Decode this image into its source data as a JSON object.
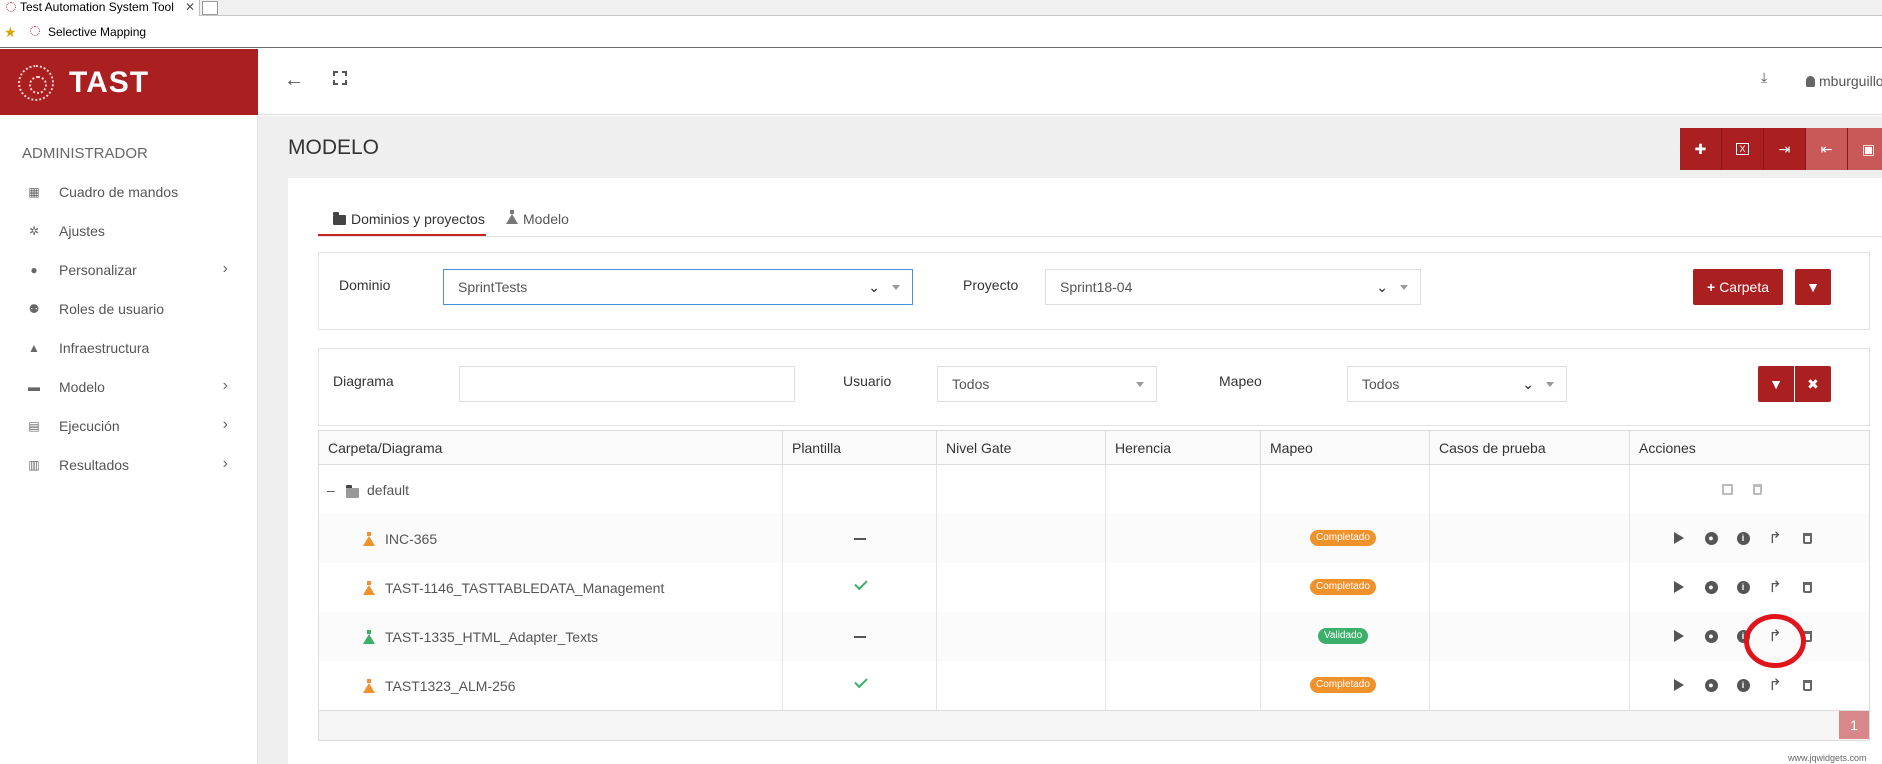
{
  "browser": {
    "tab_title": "Test Automation System Tool",
    "favorite_label": "Selective Mapping"
  },
  "brand": {
    "name": "TAST",
    "color": "#aa1f1f"
  },
  "sidebar": {
    "section": "ADMINISTRADOR",
    "items": [
      {
        "label": "Cuadro de mandos",
        "icon": "dashboard-icon",
        "has_submenu": false
      },
      {
        "label": "Ajustes",
        "icon": "gear-icon",
        "has_submenu": false
      },
      {
        "label": "Personalizar",
        "icon": "palette-icon",
        "has_submenu": true
      },
      {
        "label": "Roles de usuario",
        "icon": "users-icon",
        "has_submenu": false
      },
      {
        "label": "Infraestructura",
        "icon": "road-icon",
        "has_submenu": false
      },
      {
        "label": "Modelo",
        "icon": "briefcase-icon",
        "has_submenu": true
      },
      {
        "label": "Ejecución",
        "icon": "calendar-icon",
        "has_submenu": true
      },
      {
        "label": "Resultados",
        "icon": "bar-chart-icon",
        "has_submenu": true
      }
    ]
  },
  "header": {
    "username": "mburguillo"
  },
  "page": {
    "title": "MODELO"
  },
  "toolbar": [
    "add-icon",
    "excel-icon",
    "import-icon",
    "export-icon",
    "save-icon"
  ],
  "tabs": [
    {
      "label": "Dominios y proyectos",
      "active": true
    },
    {
      "label": "Modelo",
      "active": false
    }
  ],
  "filters1": {
    "dominio_label": "Dominio",
    "dominio_value": "SprintTests",
    "proyecto_label": "Proyecto",
    "proyecto_value": "Sprint18-04",
    "carpeta_button": "Carpeta"
  },
  "filters2": {
    "diagrama_label": "Diagrama",
    "diagrama_value": "",
    "usuario_label": "Usuario",
    "usuario_value": "Todos",
    "mapeo_label": "Mapeo",
    "mapeo_value": "Todos"
  },
  "grid": {
    "columns": [
      "Carpeta/Diagrama",
      "Plantilla",
      "Nivel Gate",
      "Herencia",
      "Mapeo",
      "Casos de prueba",
      "Acciones"
    ],
    "folder": {
      "name": "default",
      "expanded_symbol": "–"
    },
    "rows": [
      {
        "name": "INC-365",
        "plantilla": "dash",
        "mapeo": "Completado",
        "status_color": "#f0922b"
      },
      {
        "name": "TAST-1146_TASTTABLEDATA_Management",
        "plantilla": "check",
        "mapeo": "Completado",
        "status_color": "#f0922b"
      },
      {
        "name": "TAST-1335_HTML_Adapter_Texts",
        "plantilla": "dash",
        "mapeo": "Validado",
        "status_color": "#3caf6a"
      },
      {
        "name": "TAST1323_ALM-256",
        "plantilla": "check",
        "mapeo": "Completado",
        "status_color": "#f0922b"
      }
    ],
    "page": "1",
    "watermark": "www.jqwidgets.com"
  }
}
